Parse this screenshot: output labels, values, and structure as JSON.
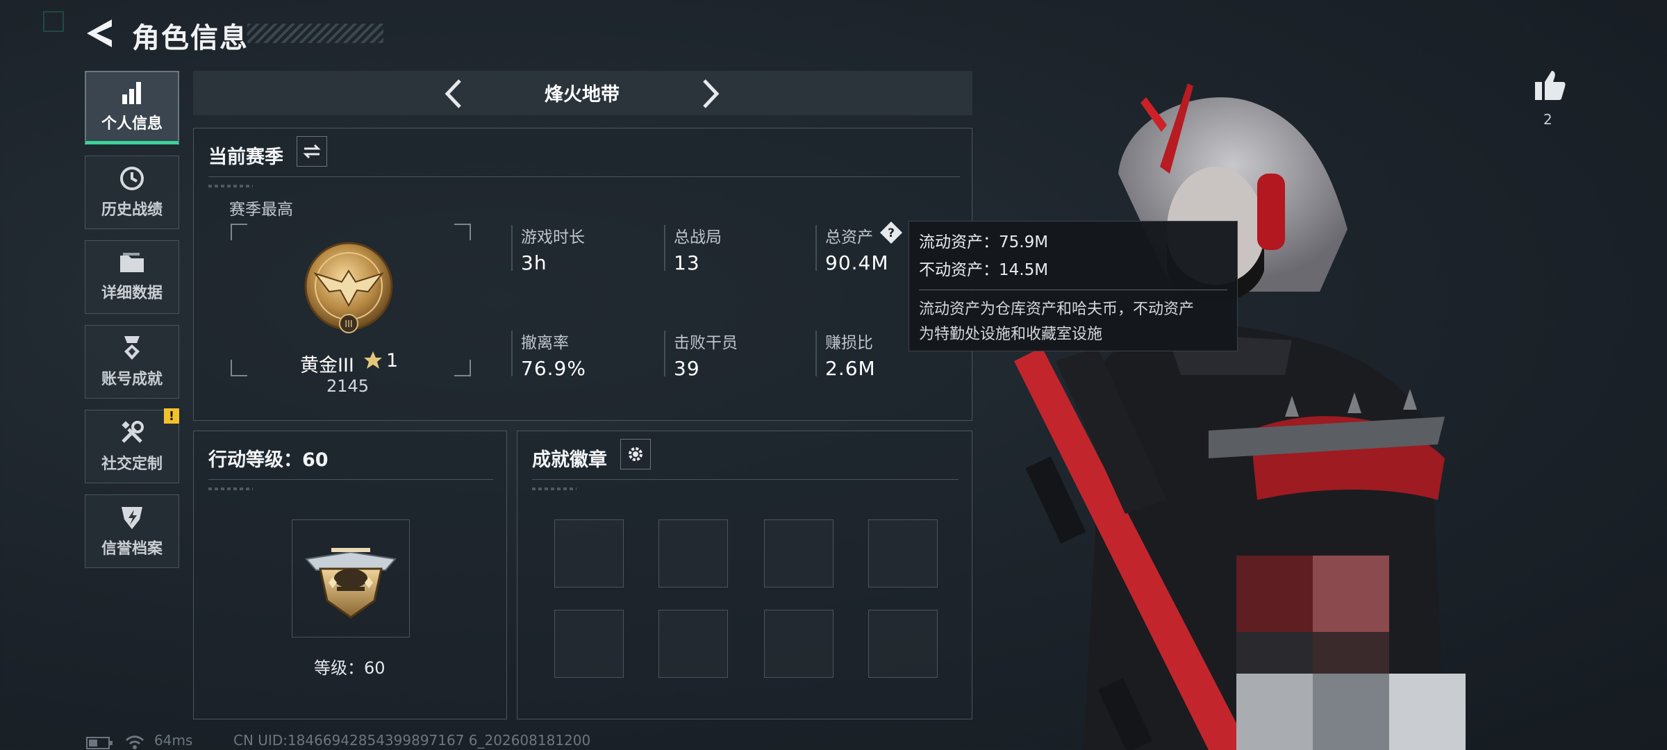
{
  "header": {
    "title": "角色信息"
  },
  "sidebar": {
    "items": [
      {
        "label": "个人信息",
        "icon": "bar-chart-icon",
        "active": true
      },
      {
        "label": "历史战绩",
        "icon": "clock-icon",
        "active": false
      },
      {
        "label": "详细数据",
        "icon": "folder-icon",
        "active": false
      },
      {
        "label": "账号成就",
        "icon": "medal-icon",
        "active": false
      },
      {
        "label": "社交定制",
        "icon": "tools-icon",
        "active": false,
        "alert": "!"
      },
      {
        "label": "信誉档案",
        "icon": "shield-icon",
        "active": false
      }
    ]
  },
  "mode_selector": {
    "title": "烽火地带"
  },
  "season": {
    "title": "当前赛季",
    "best_label": "赛季最高",
    "rank_name": "黄金III",
    "rank_stars": "1",
    "rank_points": "2145",
    "stats": [
      {
        "label": "游戏时长",
        "value": "3h"
      },
      {
        "label": "总战局",
        "value": "13"
      },
      {
        "label": "总资产",
        "value": "90.4M"
      },
      {
        "label": "撤离率",
        "value": "76.9%"
      },
      {
        "label": "击败干员",
        "value": "39"
      },
      {
        "label": "赚损比",
        "value": "2.6M"
      }
    ]
  },
  "tooltip": {
    "line1": "流动资产：75.9M",
    "line2": "不动资产：14.5M",
    "desc1": "流动资产为仓库资产和哈夫币，不动资产",
    "desc2": "为特勤处设施和收藏室设施"
  },
  "action_level": {
    "title": "行动等级：60",
    "level_text": "等级：60"
  },
  "achievement": {
    "title": "成就徽章",
    "slots": 8
  },
  "like": {
    "count": "2"
  },
  "footer": {
    "ping": "64ms",
    "uid": "CN UID:18466942854399897167 6_202608181200"
  },
  "colors": {
    "accent_green": "#39d49b",
    "alert_yellow": "#f2c12e",
    "panel_border": "#4b555e"
  }
}
